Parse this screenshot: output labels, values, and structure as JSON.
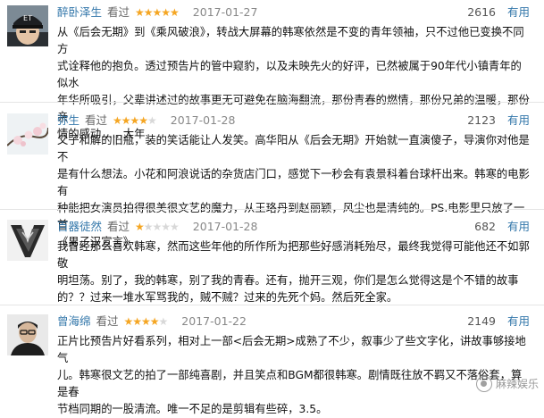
{
  "reviews": [
    {
      "author": "醉卧泽生",
      "watched": "看过",
      "rating": 5,
      "date": "2017-01-27",
      "votes": "2616",
      "useful": "有用",
      "avatar": "et-cap-avatar",
      "lines": [
        "从《后会无期》到《乘风破浪》，转战大屏幕的韩寒依然是不变的青年领袖，只不过他已变换不同方",
        "式诠释他的抱负。透过预告片的管中窥豹，以及未映先火的好评，已然被属于90年代小镇青年的似水",
        "年华所吸引，父辈讲述过的故事更无可避免在脑海翻流，那份青春的燃情，那份兄弟的温暖，那份亲",
        "情的感动……大年"
      ]
    },
    {
      "author": "弥生",
      "watched": "看过",
      "rating": 4,
      "date": "2017-01-28",
      "votes": "2123",
      "useful": "有用",
      "avatar": "blossom-avatar",
      "lines": [
        "父子和解的旧瓶，装的笑话能让人发笑。高华阳从《后会无期》开始就一直演傻子，导演你对他是不",
        "是有什么想法。小花和阿浪说话的杂货店门口，感觉下一秒会有袁景科着台球杆出来。韩寒的电影有",
        "种能把女演员拍得很美很文艺的魔力，从王珞丹到赵丽颖，风尘也是清纯的。PS.电影里只放了一首",
        "《男子汉宣言》"
      ]
    },
    {
      "author": "百器徒然",
      "watched": "看过",
      "rating": 1,
      "date": "2017-01-28",
      "votes": "682",
      "useful": "有用",
      "avatar": "dark-emblem-avatar",
      "lines": [
        "我曾经那么喜欢韩寒，然而这些年他的所作所为把那些好感消耗殆尽，最终我觉得可能他还不如郭敬",
        "明坦荡。别了，我的韩寒，别了我的青春。还有，抛开三观，你们是怎么觉得这是个不错的故事",
        "的？？过来一堆水军骂我的，贼不贼？过来的先死个妈。然后死全家。"
      ]
    },
    {
      "author": "曾海绵",
      "watched": "看过",
      "rating": 4,
      "date": "2017-01-22",
      "votes": "2149",
      "useful": "有用",
      "avatar": "portrait-avatar",
      "lines": [
        "正片比预告片好看系列，相对上一部<后会无期>成熟了不少，叙事少了些文字化，讲故事够接地气",
        "儿。韩寒很文艺的拍了一部纯喜剧，并且笑点和BGM都很韩寒。剧情既往放不羁又不落俗套，算是春",
        "节档同期的一股清流。唯一不足的是剪辑有些碎，3.5。"
      ]
    }
  ],
  "watermark": "麻辣娱乐",
  "colors": {
    "author": "#3377aa",
    "star": "#f5a623",
    "star_off": "#d8d8d8"
  }
}
